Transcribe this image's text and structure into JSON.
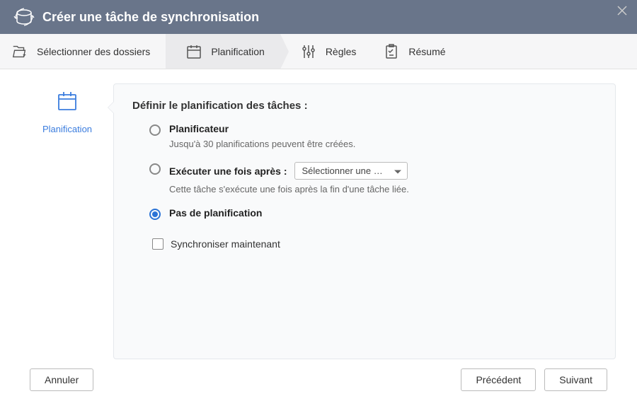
{
  "header": {
    "title": "Créer une tâche de synchronisation"
  },
  "steps": {
    "select": "Sélectionner des dossiers",
    "schedule": "Planification",
    "rules": "Règles",
    "summary": "Résumé"
  },
  "sidebar": {
    "label": "Planification"
  },
  "panel": {
    "title": "Définir le planification des tâches :",
    "option_scheduler": {
      "label": "Planificateur",
      "desc": "Jusqu'à 30 planifications peuvent être créées."
    },
    "option_after": {
      "label": "Exécuter une fois après :",
      "select_text": "Sélectionner une …",
      "desc": "Cette tâche s'exécute une fois après la fin d'une tâche liée."
    },
    "option_none": {
      "label": "Pas de planification"
    },
    "sync_now": "Synchroniser maintenant"
  },
  "footer": {
    "cancel": "Annuler",
    "prev": "Précédent",
    "next": "Suivant"
  }
}
